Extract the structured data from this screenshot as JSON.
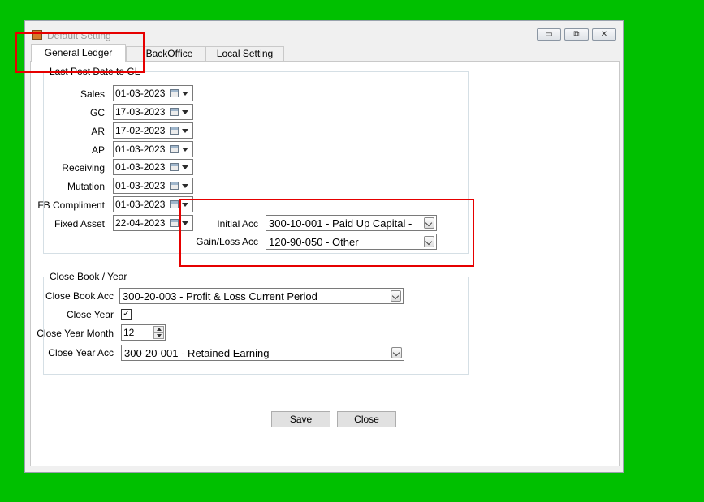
{
  "window": {
    "title": "Default Setting"
  },
  "titlebar_buttons": {
    "minimize": "▭",
    "maximize": "⧉",
    "close": "✕"
  },
  "tabs": [
    {
      "label": "General Ledger"
    },
    {
      "label": "BackOffice"
    },
    {
      "label": "Local Setting"
    }
  ],
  "gl": {
    "group_title": "Last Post Date to GL",
    "rows": [
      {
        "label": "Sales",
        "value": "01-03-2023"
      },
      {
        "label": "GC",
        "value": "17-03-2023"
      },
      {
        "label": "AR",
        "value": "17-02-2023"
      },
      {
        "label": "AP",
        "value": "01-03-2023"
      },
      {
        "label": "Receiving",
        "value": "01-03-2023"
      },
      {
        "label": "Mutation",
        "value": "01-03-2023"
      },
      {
        "label": "FB Compliment",
        "value": "01-03-2023"
      },
      {
        "label": "Fixed Asset",
        "value": "22-04-2023"
      }
    ],
    "initial_acc_label": "Initial Acc",
    "initial_acc_value": "300-10-001 - Paid Up Capital -",
    "gainloss_acc_label": "Gain/Loss Acc",
    "gainloss_acc_value": "120-90-050 - Other"
  },
  "close_book": {
    "group_title": "Close Book / Year",
    "close_book_acc_label": "Close Book Acc",
    "close_book_acc_value": "300-20-003 - Profit & Loss Current Period",
    "close_year_label": "Close Year",
    "close_year_checked": true,
    "close_year_mark": "✓",
    "close_year_month_label": "Close Year Month",
    "close_year_month_value": "12",
    "close_year_acc_label": "Close Year Acc",
    "close_year_acc_value": "300-20-001 - Retained Earning"
  },
  "buttons": {
    "save": "Save",
    "close": "Close"
  },
  "colors": {
    "background": "#00c000",
    "highlight": "#e60000",
    "window": "#f0f0f0"
  }
}
